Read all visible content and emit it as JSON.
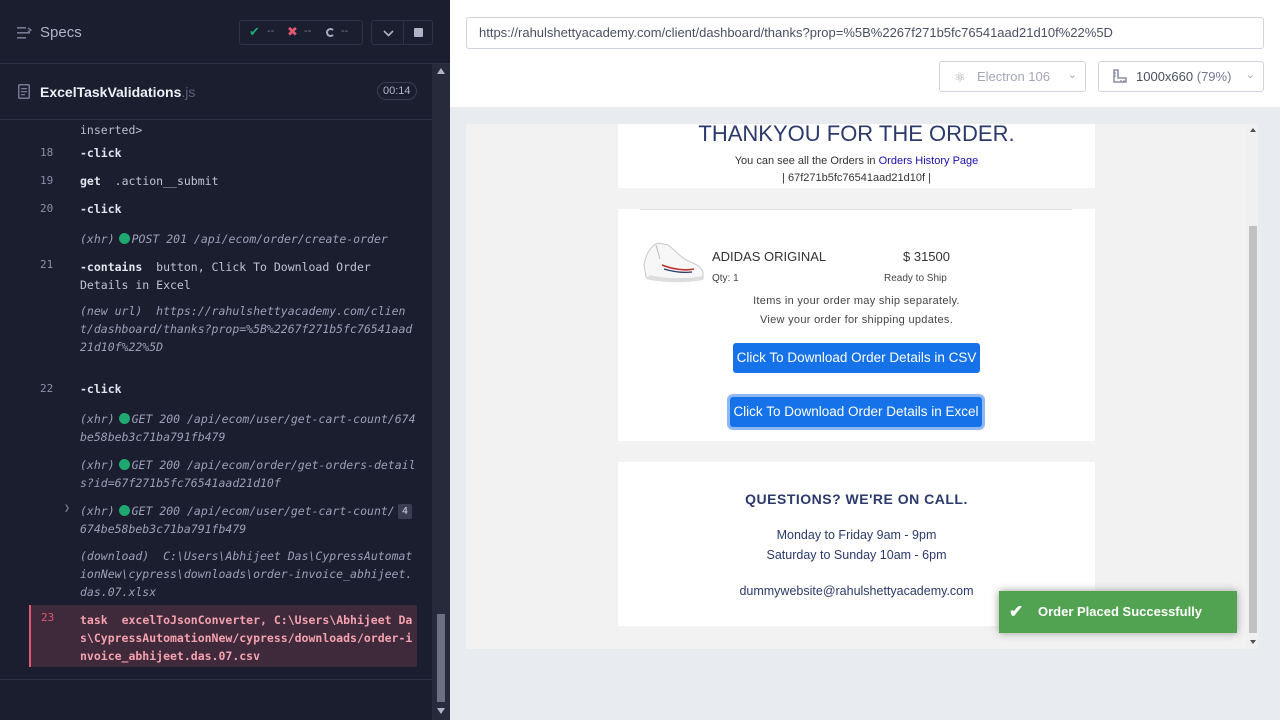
{
  "sidebar": {
    "specs_label": "Specs",
    "stats": {
      "passed": "--",
      "failed": "--",
      "pending": "--"
    },
    "file": {
      "name": "ExcelTaskValidations",
      "ext": ".js",
      "duration": "00:14"
    }
  },
  "log": {
    "inserted_tail": "inserted>",
    "rows": [
      {
        "num": "18",
        "cmd": "-click",
        "msg": ""
      },
      {
        "num": "19",
        "cmd": "get",
        "msg": ".action__submit"
      },
      {
        "num": "20",
        "cmd": "-click",
        "msg": ""
      },
      {
        "num": "21",
        "cmd": "-contains",
        "msg": "button, Click To Download Order Details in Excel"
      },
      {
        "num": "22",
        "cmd": "-click",
        "msg": ""
      }
    ],
    "xhr_create": {
      "type": "(xhr)",
      "text": "POST 201 /api/ecom/order/create-order"
    },
    "new_url": {
      "type": "(new url)",
      "text": "https://rahulshettyacademy.com/client/dashboard/thanks?prop=%5B%2267f271b5fc76541aad21d10f%22%5D"
    },
    "xhr_cart1": {
      "type": "(xhr)",
      "text": "GET 200 /api/ecom/user/get-cart-count/674be58beb3c71ba791fb479"
    },
    "xhr_orders": {
      "type": "(xhr)",
      "text": "GET 200 /api/ecom/order/get-orders-details?id=67f271b5fc76541aad21d10f"
    },
    "xhr_cart2": {
      "type": "(xhr)",
      "text": "GET 200 /api/ecom/user/get-cart-count/674be58beb3c71ba791fb479",
      "count": "4"
    },
    "download": {
      "type": "(download)",
      "text": "C:\\Users\\Abhijeet Das\\CypressAutomationNew\\cypress\\downloads\\order-invoice_abhijeet.das.07.xlsx"
    },
    "failed": {
      "num": "23",
      "cmd": "task",
      "text": "excelToJsonConverter, C:\\Users\\Abhijeet Das\\CypressAutomationNew/cypress/downloads/order-invoice_abhijeet.das.07.csv"
    }
  },
  "browser": {
    "url": "https://rahulshettyacademy.com/client/dashboard/thanks?prop=%5B%2267f271b5fc76541aad21d10f%22%5D",
    "engine": "Electron 106",
    "viewport": "1000x660",
    "zoom": "(79%)"
  },
  "app": {
    "thanks_heading": "THANKYOU FOR THE ORDER.",
    "orders_text": "You can see all the Orders in",
    "orders_link": "Orders History Page",
    "order_id": "| 67f271b5fc76541aad21d10f |",
    "product": {
      "name": "ADIDAS ORIGINAL",
      "price": "$ 31500",
      "qty": "Qty: 1",
      "status": "Ready to Ship"
    },
    "note1": "Items in your order may ship separately.",
    "note2": "View your order for shipping updates.",
    "btn_csv": "Click To Download Order Details in CSV",
    "btn_excel": "Click To Download Order Details in Excel",
    "questions_heading": "QUESTIONS? WE'RE ON CALL.",
    "hours1": "Monday to Friday 9am - 9pm",
    "hours2": "Saturday to Sunday 10am - 6pm",
    "email": "dummywebsite@rahulshettyacademy.com",
    "toast": "Order Placed Successfully"
  },
  "colors": {
    "pass": "#1fa971",
    "fail": "#e45770",
    "button": "#1572e8",
    "toast": "#51a351"
  }
}
